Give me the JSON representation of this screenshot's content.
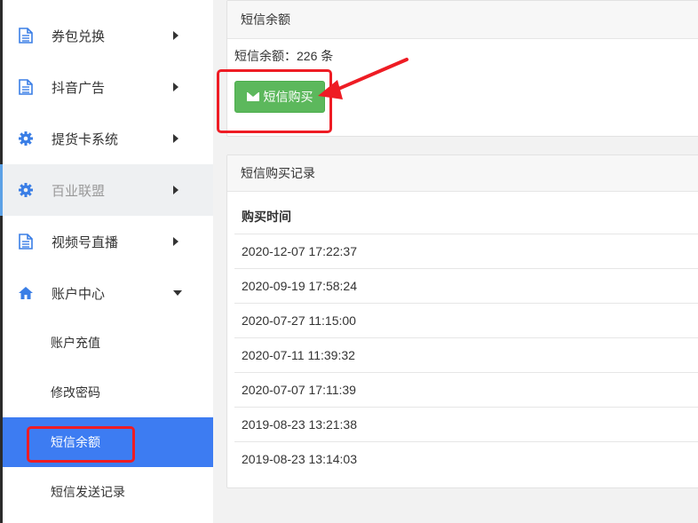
{
  "sidebar": {
    "items": [
      {
        "label": "券包兑换",
        "icon": "document-icon"
      },
      {
        "label": "抖音广告",
        "icon": "document-icon"
      },
      {
        "label": "提货卡系统",
        "icon": "gear-icon"
      },
      {
        "label": "百业联盟",
        "icon": "gear-icon"
      },
      {
        "label": "视频号直播",
        "icon": "document-icon"
      },
      {
        "label": "账户中心",
        "icon": "home-icon"
      }
    ],
    "sub_items": [
      {
        "label": "账户充值"
      },
      {
        "label": "修改密码"
      },
      {
        "label": "短信余额"
      },
      {
        "label": "短信发送记录"
      }
    ]
  },
  "balance_panel": {
    "title": "短信余额",
    "balance_text": "短信余额：226 条",
    "buy_button": "短信购买"
  },
  "records_panel": {
    "title": "短信购买记录",
    "column_header": "购买时间",
    "rows": [
      "2020-12-07 17:22:37",
      "2020-09-19 17:58:24",
      "2020-07-27 11:15:00",
      "2020-07-11 11:39:32",
      "2020-07-07 17:11:39",
      "2019-08-23 13:21:38",
      "2019-08-23 13:14:03"
    ]
  },
  "colors": {
    "accent_blue": "#3d7cf2",
    "button_green": "#5cb85c",
    "highlight_red": "#ee1c24"
  }
}
